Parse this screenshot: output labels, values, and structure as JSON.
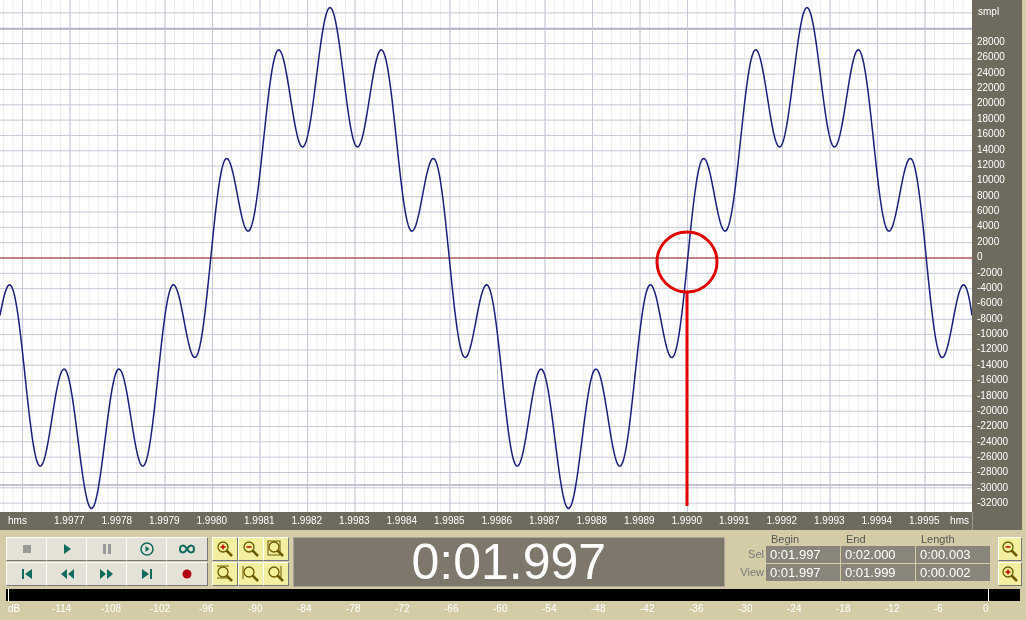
{
  "waveform": {
    "y_unit": "smpl",
    "y_ticks": [
      "28000",
      "26000",
      "24000",
      "22000",
      "20000",
      "18000",
      "16000",
      "14000",
      "12000",
      "10000",
      "8000",
      "6000",
      "4000",
      "2000",
      "0",
      "-2000",
      "-4000",
      "-6000",
      "-8000",
      "-10000",
      "-12000",
      "-14000",
      "-16000",
      "-18000",
      "-20000",
      "-22000",
      "-24000",
      "-26000",
      "-28000",
      "-30000",
      "-32000"
    ],
    "x_unit_left": "hms",
    "x_unit_right": "hms",
    "x_ticks": [
      "1.9977",
      "1.9978",
      "1.9979",
      "1.9980",
      "1.9981",
      "1.9982",
      "1.9983",
      "1.9984",
      "1.9985",
      "1.9986",
      "1.9987",
      "1.9988",
      "1.9989",
      "1.9990",
      "1.9991",
      "1.9992",
      "1.9993",
      "1.9994",
      "1.9995"
    ]
  },
  "transport": [
    {
      "kind": "stop",
      "disabled": true
    },
    {
      "kind": "play",
      "disabled": false
    },
    {
      "kind": "pause",
      "disabled": true
    },
    {
      "kind": "play-to-end",
      "disabled": false
    },
    {
      "kind": "loop",
      "disabled": false
    },
    {
      "kind": "go-to-start",
      "disabled": false
    },
    {
      "kind": "rewind",
      "disabled": false
    },
    {
      "kind": "fast-forward",
      "disabled": false
    },
    {
      "kind": "go-to-end",
      "disabled": false
    },
    {
      "kind": "record",
      "disabled": false
    }
  ],
  "zoom_buttons": [
    {
      "kind": "zoom-in"
    },
    {
      "kind": "zoom-out"
    },
    {
      "kind": "zoom-full"
    },
    {
      "kind": "zoom-selection"
    },
    {
      "kind": "zoom-left"
    },
    {
      "kind": "zoom-right"
    }
  ],
  "time_display": "0:01.997",
  "selection": {
    "columns": [
      "Begin",
      "End",
      "Length"
    ],
    "rows": [
      {
        "label": "Sel",
        "values": [
          "0:01.997",
          "0:02.000",
          "0:00.003"
        ]
      },
      {
        "label": "View",
        "values": [
          "0:01.997",
          "0:01.999",
          "0:00.002"
        ]
      }
    ]
  },
  "vertical_zoom": [
    {
      "kind": "zoom-out"
    },
    {
      "kind": "zoom-in"
    }
  ],
  "level_meter": {
    "unit": "dB",
    "ticks": [
      "-114",
      "-108",
      "-102",
      "-96",
      "-90",
      "-84",
      "-78",
      "-72",
      "-66",
      "-60",
      "-54",
      "-48",
      "-42",
      "-36",
      "-30",
      "-24",
      "-18",
      "-12",
      "-6",
      "0"
    ]
  }
}
